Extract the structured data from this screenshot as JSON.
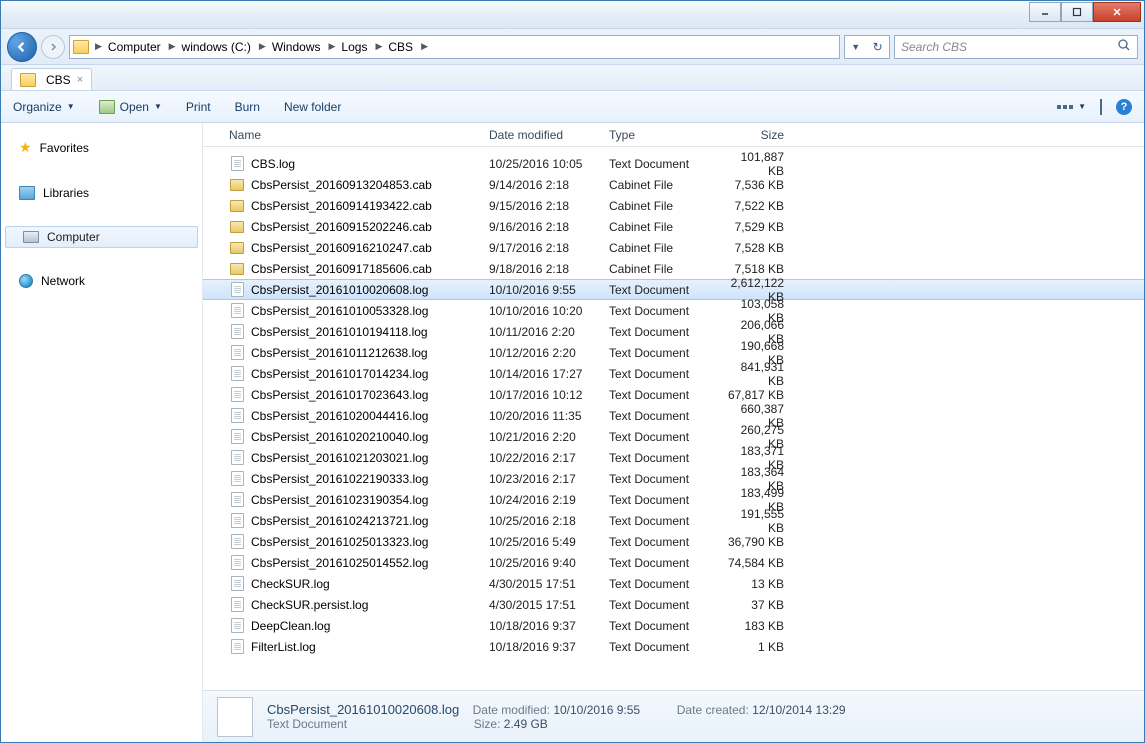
{
  "breadcrumb": [
    "Computer",
    "windows (C:)",
    "Windows",
    "Logs",
    "CBS"
  ],
  "search_placeholder": "Search CBS",
  "tab_label": "CBS",
  "toolbar": {
    "organize": "Organize",
    "open": "Open",
    "print": "Print",
    "burn": "Burn",
    "new_folder": "New folder"
  },
  "nav": {
    "favorites": "Favorites",
    "libraries": "Libraries",
    "computer": "Computer",
    "network": "Network"
  },
  "columns": {
    "name": "Name",
    "date": "Date modified",
    "type": "Type",
    "size": "Size"
  },
  "files": [
    {
      "name": "CBS.log",
      "date": "10/25/2016 10:05",
      "type": "Text Document",
      "size": "101,887 KB",
      "icon": "file",
      "selected": false
    },
    {
      "name": "CbsPersist_20160913204853.cab",
      "date": "9/14/2016 2:18",
      "type": "Cabinet File",
      "size": "7,536 KB",
      "icon": "cab",
      "selected": false
    },
    {
      "name": "CbsPersist_20160914193422.cab",
      "date": "9/15/2016 2:18",
      "type": "Cabinet File",
      "size": "7,522 KB",
      "icon": "cab",
      "selected": false
    },
    {
      "name": "CbsPersist_20160915202246.cab",
      "date": "9/16/2016 2:18",
      "type": "Cabinet File",
      "size": "7,529 KB",
      "icon": "cab",
      "selected": false
    },
    {
      "name": "CbsPersist_20160916210247.cab",
      "date": "9/17/2016 2:18",
      "type": "Cabinet File",
      "size": "7,528 KB",
      "icon": "cab",
      "selected": false
    },
    {
      "name": "CbsPersist_20160917185606.cab",
      "date": "9/18/2016 2:18",
      "type": "Cabinet File",
      "size": "7,518 KB",
      "icon": "cab",
      "selected": false
    },
    {
      "name": "CbsPersist_20161010020608.log",
      "date": "10/10/2016 9:55",
      "type": "Text Document",
      "size": "2,612,122 KB",
      "icon": "file",
      "selected": true
    },
    {
      "name": "CbsPersist_20161010053328.log",
      "date": "10/10/2016 10:20",
      "type": "Text Document",
      "size": "103,058 KB",
      "icon": "file",
      "selected": false
    },
    {
      "name": "CbsPersist_20161010194118.log",
      "date": "10/11/2016 2:20",
      "type": "Text Document",
      "size": "206,066 KB",
      "icon": "file",
      "selected": false
    },
    {
      "name": "CbsPersist_20161011212638.log",
      "date": "10/12/2016 2:20",
      "type": "Text Document",
      "size": "190,668 KB",
      "icon": "file",
      "selected": false
    },
    {
      "name": "CbsPersist_20161017014234.log",
      "date": "10/14/2016 17:27",
      "type": "Text Document",
      "size": "841,931 KB",
      "icon": "file",
      "selected": false
    },
    {
      "name": "CbsPersist_20161017023643.log",
      "date": "10/17/2016 10:12",
      "type": "Text Document",
      "size": "67,817 KB",
      "icon": "file",
      "selected": false
    },
    {
      "name": "CbsPersist_20161020044416.log",
      "date": "10/20/2016 11:35",
      "type": "Text Document",
      "size": "660,387 KB",
      "icon": "file",
      "selected": false
    },
    {
      "name": "CbsPersist_20161020210040.log",
      "date": "10/21/2016 2:20",
      "type": "Text Document",
      "size": "260,275 KB",
      "icon": "file",
      "selected": false
    },
    {
      "name": "CbsPersist_20161021203021.log",
      "date": "10/22/2016 2:17",
      "type": "Text Document",
      "size": "183,371 KB",
      "icon": "file",
      "selected": false
    },
    {
      "name": "CbsPersist_20161022190333.log",
      "date": "10/23/2016 2:17",
      "type": "Text Document",
      "size": "183,364 KB",
      "icon": "file",
      "selected": false
    },
    {
      "name": "CbsPersist_20161023190354.log",
      "date": "10/24/2016 2:19",
      "type": "Text Document",
      "size": "183,499 KB",
      "icon": "file",
      "selected": false
    },
    {
      "name": "CbsPersist_20161024213721.log",
      "date": "10/25/2016 2:18",
      "type": "Text Document",
      "size": "191,555 KB",
      "icon": "file",
      "selected": false
    },
    {
      "name": "CbsPersist_20161025013323.log",
      "date": "10/25/2016 5:49",
      "type": "Text Document",
      "size": "36,790 KB",
      "icon": "file",
      "selected": false
    },
    {
      "name": "CbsPersist_20161025014552.log",
      "date": "10/25/2016 9:40",
      "type": "Text Document",
      "size": "74,584 KB",
      "icon": "file",
      "selected": false
    },
    {
      "name": "CheckSUR.log",
      "date": "4/30/2015 17:51",
      "type": "Text Document",
      "size": "13 KB",
      "icon": "file",
      "selected": false
    },
    {
      "name": "CheckSUR.persist.log",
      "date": "4/30/2015 17:51",
      "type": "Text Document",
      "size": "37 KB",
      "icon": "file",
      "selected": false
    },
    {
      "name": "DeepClean.log",
      "date": "10/18/2016 9:37",
      "type": "Text Document",
      "size": "183 KB",
      "icon": "file",
      "selected": false
    },
    {
      "name": "FilterList.log",
      "date": "10/18/2016 9:37",
      "type": "Text Document",
      "size": "1 KB",
      "icon": "file",
      "selected": false
    }
  ],
  "details": {
    "filename": "CbsPersist_20161010020608.log",
    "filetype": "Text Document",
    "date_modified_label": "Date modified:",
    "date_modified": "10/10/2016 9:55",
    "size_label": "Size:",
    "size": "2.49 GB",
    "date_created_label": "Date created:",
    "date_created": "12/10/2014 13:29"
  }
}
